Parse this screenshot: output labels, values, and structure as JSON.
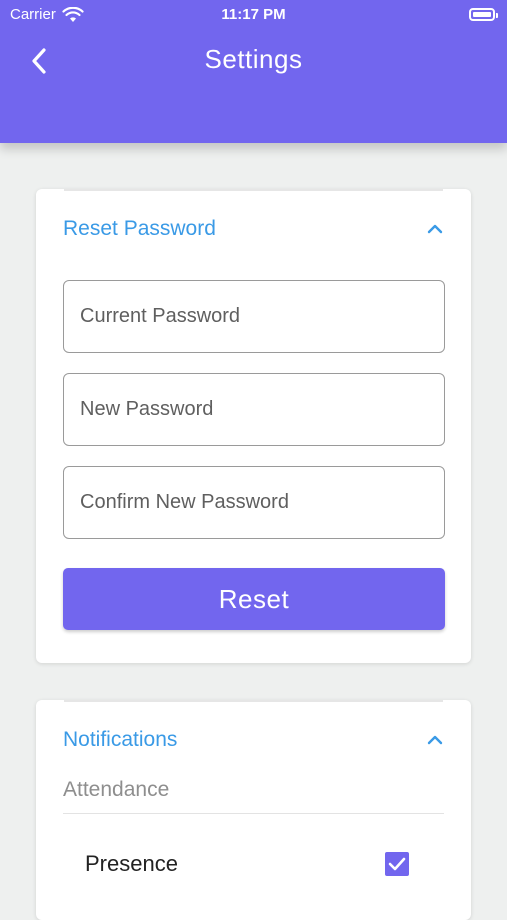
{
  "status_bar": {
    "carrier": "Carrier",
    "time": "11:17 PM"
  },
  "header": {
    "title": "Settings"
  },
  "reset_password": {
    "heading": "Reset Password",
    "expanded": true,
    "fields": {
      "current_placeholder": "Current Password",
      "new_placeholder": "New Password",
      "confirm_placeholder": "Confirm New Password"
    },
    "button_label": "Reset"
  },
  "notifications": {
    "heading": "Notifications",
    "expanded": true,
    "group_label": "Attendance",
    "items": [
      {
        "label": "Presence",
        "checked": true
      }
    ]
  },
  "colors": {
    "primary": "#7266ee",
    "accent_text": "#3a9ae6",
    "background": "#eef0ef"
  }
}
